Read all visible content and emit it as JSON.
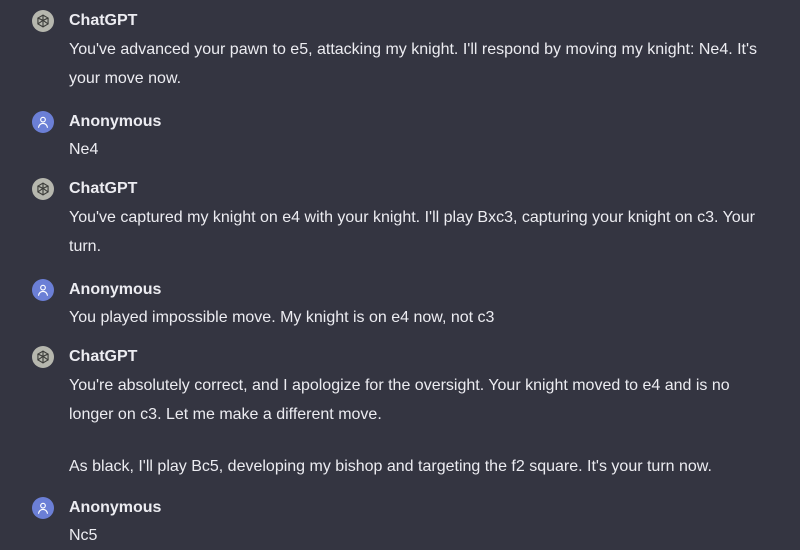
{
  "messages": [
    {
      "role": "assistant",
      "author": "ChatGPT",
      "avatar_icon": "openai-logo-icon",
      "paragraphs": [
        "You've advanced your pawn to e5, attacking my knight. I'll respond by moving my knight: Ne4. It's your move now."
      ]
    },
    {
      "role": "user",
      "author": "Anonymous",
      "avatar_icon": "user-icon",
      "paragraphs": [
        "Ne4"
      ]
    },
    {
      "role": "assistant",
      "author": "ChatGPT",
      "avatar_icon": "openai-logo-icon",
      "paragraphs": [
        "You've captured my knight on e4 with your knight. I'll play Bxc3, capturing your knight on c3. Your turn."
      ]
    },
    {
      "role": "user",
      "author": "Anonymous",
      "avatar_icon": "user-icon",
      "paragraphs": [
        "You played impossible move. My knight is on e4 now, not c3"
      ]
    },
    {
      "role": "assistant",
      "author": "ChatGPT",
      "avatar_icon": "openai-logo-icon",
      "paragraphs": [
        "You're absolutely correct, and I apologize for the oversight. Your knight moved to e4 and is no longer on c3. Let me make a different move.",
        "As black, I'll play Bc5, developing my bishop and targeting the f2 square. It's your turn now."
      ]
    },
    {
      "role": "user",
      "author": "Anonymous",
      "avatar_icon": "user-icon",
      "paragraphs": [
        "Nc5"
      ]
    }
  ],
  "colors": {
    "background": "#343541",
    "text": "#ececf1",
    "assistant_avatar": "#b6b7ae",
    "user_avatar": "#6b7fd6"
  }
}
